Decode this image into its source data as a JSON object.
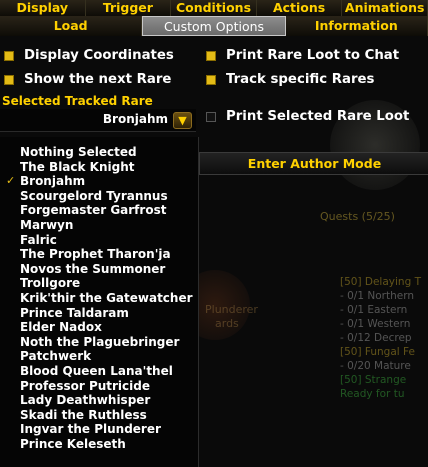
{
  "top_tabs": [
    "Display",
    "Trigger",
    "Conditions",
    "Actions",
    "Animations"
  ],
  "sub_tabs": [
    "Load",
    "Custom Options",
    "Information"
  ],
  "active_sub_tab": "Custom Options",
  "options": {
    "display_coordinates": {
      "label": "Display Coordinates",
      "checked": true
    },
    "show_next_rare": {
      "label": "Show the next Rare",
      "checked": true
    },
    "print_rare_loot_chat": {
      "label": "Print Rare Loot to Chat",
      "checked": true
    },
    "track_specific_rares": {
      "label": "Track specific Rares",
      "checked": true
    },
    "print_selected_rare_loot": {
      "label": "Print Selected Rare Loot",
      "checked": false
    }
  },
  "selected_tracked_rare": {
    "label": "Selected Tracked Rare",
    "value": "Bronjahm"
  },
  "author_mode_button": "Enter Author Mode",
  "rare_list": [
    "Nothing Selected",
    "The Black Knight",
    "Bronjahm",
    "Scourgelord Tyrannus",
    "Forgemaster Garfrost",
    "Marwyn",
    "Falric",
    "The Prophet Tharon'ja",
    "Novos the Summoner",
    "Trollgore",
    "Krik'thir the Gatewatcher",
    "Prince Taldaram",
    "Elder Nadox",
    "Noth the Plaguebringer",
    "Patchwerk",
    "Blood Queen Lana'thel",
    "Professor Putricide",
    "Lady Deathwhisper",
    "Skadi the Ruthless",
    "Ingvar the Plunderer",
    "Prince Keleseth"
  ],
  "selected_index": 2,
  "background": {
    "quests_header": "Quests (5/25)",
    "lines": [
      {
        "text": "[50] Delaying T",
        "kind": "q"
      },
      {
        "text": "- 0/1 Northern",
        "kind": "n"
      },
      {
        "text": "- 0/1 Eastern",
        "kind": "n"
      },
      {
        "text": "- 0/1 Western",
        "kind": "n"
      },
      {
        "text": "- 0/12 Decrep",
        "kind": "n"
      },
      {
        "text": "[50] Fungal Fe",
        "kind": "q"
      },
      {
        "text": "- 0/20 Mature",
        "kind": "n"
      },
      {
        "text": "[50] Strange",
        "kind": "g"
      },
      {
        "text": "Ready for tu",
        "kind": "g"
      }
    ],
    "plunderer_text": "Plunderer",
    "wards_text": "ards"
  },
  "colors": {
    "gold": "#ffd100",
    "check": "#e3bb16",
    "panel": "#050505"
  }
}
